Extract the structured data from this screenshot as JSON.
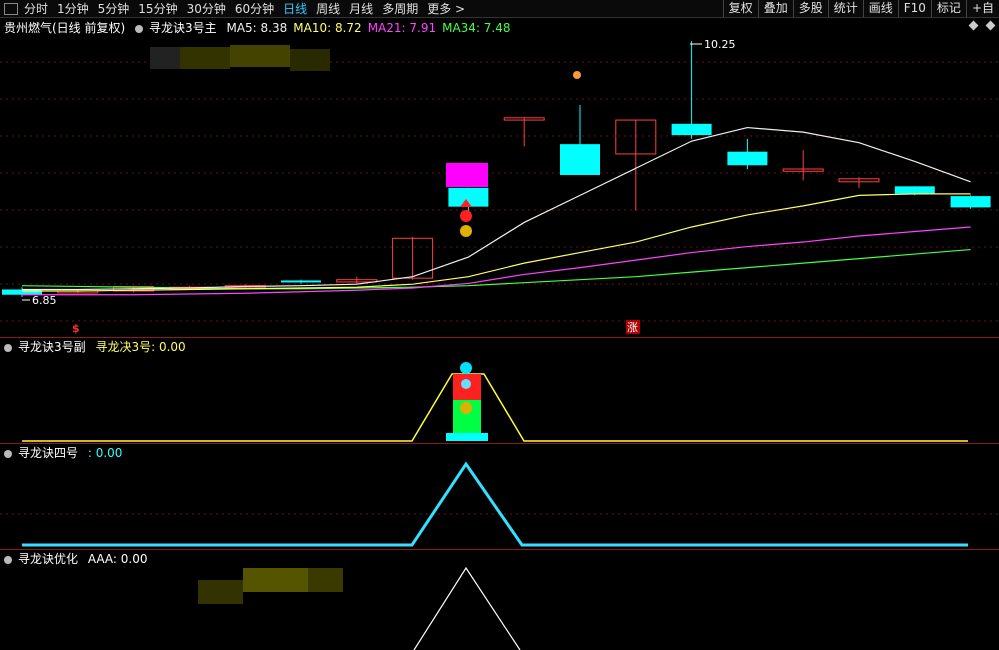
{
  "toolbar": {
    "periods": [
      "分时",
      "1分钟",
      "5分钟",
      "15分钟",
      "30分钟",
      "60分钟",
      "日线",
      "周线",
      "月线",
      "多周期",
      "更多 >"
    ],
    "active_period": "日线",
    "right_buttons": [
      "复权",
      "叠加",
      "多股",
      "统计",
      "画线",
      "F10",
      "标记",
      "+自"
    ]
  },
  "main": {
    "stock": "贵州燃气(日线 前复权)",
    "indicator": "寻龙诀3号主",
    "ma": [
      {
        "label": "MA5: 8.38",
        "color": "#f0f0f0"
      },
      {
        "label": "MA10: 8.72",
        "color": "#ffff66"
      },
      {
        "label": "MA21: 7.91",
        "color": "#ff44ff"
      },
      {
        "label": "MA34: 7.48",
        "color": "#44ff44"
      }
    ],
    "high_label": "10.25",
    "low_label": "6.85",
    "signal_mark": "$",
    "zhang_mark": "涨"
  },
  "sub1": {
    "title": "寻龙诀3号副",
    "value_label": "寻龙决3号: 0.00"
  },
  "sub2": {
    "title": "寻龙诀四号",
    "value_label": ": 0.00"
  },
  "sub3": {
    "title": "寻龙诀优化",
    "value_label": "AAA: 0.00"
  },
  "chart_data": {
    "type": "candlestick",
    "y_range": [
      6.85,
      10.25
    ],
    "candles": [
      {
        "o": 6.88,
        "c": 6.95,
        "h": 6.98,
        "l": 6.85,
        "up": false
      },
      {
        "o": 6.92,
        "c": 6.93,
        "h": 6.95,
        "l": 6.9,
        "up": true
      },
      {
        "o": 6.93,
        "c": 6.99,
        "h": 7.0,
        "l": 6.91,
        "up": true
      },
      {
        "o": 6.98,
        "c": 6.97,
        "h": 7.0,
        "l": 6.96,
        "up": true
      },
      {
        "o": 6.98,
        "c": 7.0,
        "h": 7.02,
        "l": 6.96,
        "up": true
      },
      {
        "o": 7.07,
        "c": 7.05,
        "h": 7.08,
        "l": 7.03,
        "up": false
      },
      {
        "o": 7.05,
        "c": 7.08,
        "h": 7.12,
        "l": 7.02,
        "up": true
      },
      {
        "o": 7.1,
        "c": 7.63,
        "h": 7.65,
        "l": 7.08,
        "up": true
      },
      {
        "o": 8.3,
        "c": 8.05,
        "h": 8.3,
        "l": 7.88,
        "up": false
      },
      {
        "o": 9.23,
        "c": 9.2,
        "h": 9.23,
        "l": 8.85,
        "up": true
      },
      {
        "o": 8.47,
        "c": 8.88,
        "h": 9.4,
        "l": 8.47,
        "up": false
      },
      {
        "o": 8.75,
        "c": 9.2,
        "h": 9.2,
        "l": 8.0,
        "up": true
      },
      {
        "o": 9.15,
        "c": 9.0,
        "h": 10.25,
        "l": 8.95,
        "up": false
      },
      {
        "o": 8.78,
        "c": 8.6,
        "h": 8.95,
        "l": 8.55,
        "up": false
      },
      {
        "o": 8.55,
        "c": 8.52,
        "h": 8.8,
        "l": 8.4,
        "up": true
      },
      {
        "o": 8.42,
        "c": 8.38,
        "h": 8.44,
        "l": 8.3,
        "up": true
      },
      {
        "o": 8.32,
        "c": 8.22,
        "h": 8.32,
        "l": 8.2,
        "up": false
      },
      {
        "o": 8.19,
        "c": 8.04,
        "h": 8.2,
        "l": 8.02,
        "up": false
      }
    ],
    "ma5": [
      6.95,
      6.95,
      6.96,
      6.97,
      6.99,
      7.0,
      7.02,
      7.12,
      7.38,
      7.84,
      8.2,
      8.56,
      8.92,
      9.1,
      9.04,
      8.9,
      8.65,
      8.38
    ],
    "ma10": [
      6.93,
      6.93,
      6.94,
      6.95,
      6.96,
      6.97,
      6.98,
      7.02,
      7.12,
      7.3,
      7.44,
      7.58,
      7.78,
      7.94,
      8.06,
      8.2,
      8.22,
      8.22
    ],
    "ma21": [
      6.88,
      6.88,
      6.88,
      6.89,
      6.9,
      6.92,
      6.94,
      6.97,
      7.03,
      7.15,
      7.24,
      7.34,
      7.44,
      7.52,
      7.58,
      7.66,
      7.72,
      7.78
    ],
    "ma34": [
      7.0,
      6.99,
      6.98,
      6.97,
      6.96,
      6.96,
      6.97,
      6.98,
      7.0,
      7.04,
      7.08,
      7.12,
      7.18,
      7.24,
      7.3,
      7.36,
      7.42,
      7.48
    ]
  }
}
